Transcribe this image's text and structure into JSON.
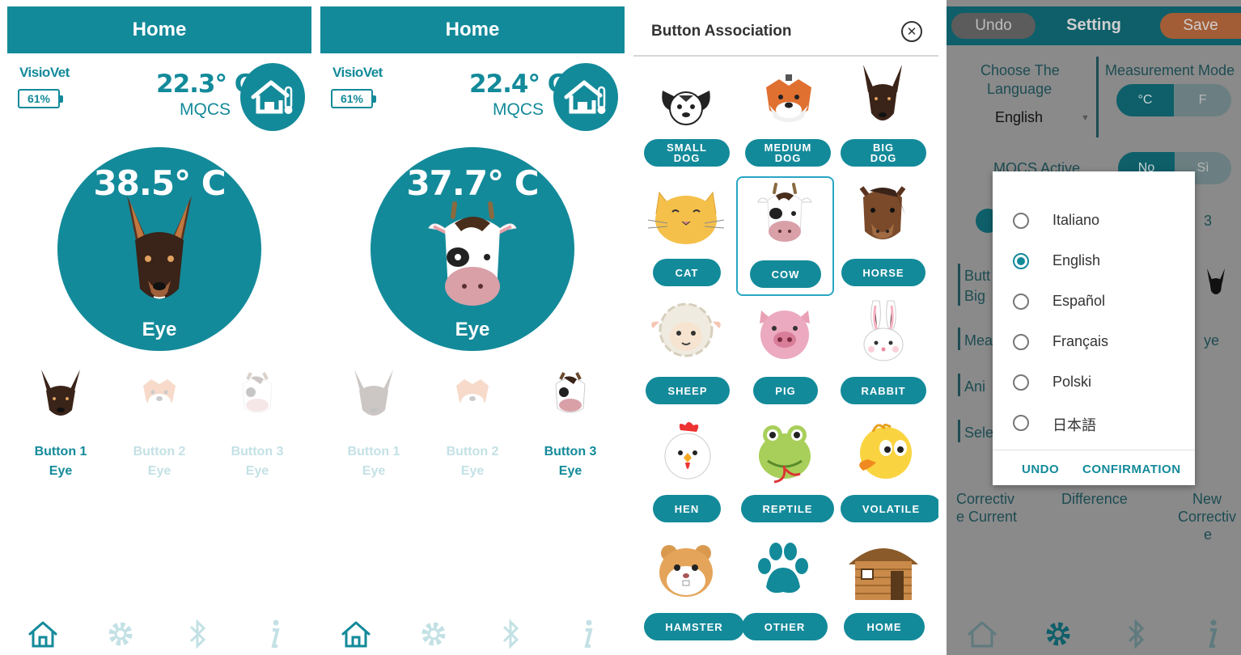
{
  "screen1": {
    "title": "Home",
    "brand": "VisioVet",
    "battery": "61%",
    "ambient_temp": "22.3° C",
    "ambient_label": "MQCS",
    "body_temp": "38.5° C",
    "body_site": "Eye",
    "buttons": [
      {
        "label": "Button 1",
        "site": "Eye",
        "active": true
      },
      {
        "label": "Button 2",
        "site": "Eye",
        "active": false
      },
      {
        "label": "Button 3",
        "site": "Eye",
        "active": false
      }
    ]
  },
  "screen2": {
    "title": "Home",
    "brand": "VisioVet",
    "battery": "61%",
    "ambient_temp": "22.4° C",
    "ambient_label": "MQCS",
    "body_temp": "37.7° C",
    "body_site": "Eye",
    "buttons": [
      {
        "label": "Button 1",
        "site": "Eye",
        "active": false
      },
      {
        "label": "Button 2",
        "site": "Eye",
        "active": false
      },
      {
        "label": "Button 3",
        "site": "Eye",
        "active": true
      }
    ]
  },
  "assoc": {
    "title": "Button Association",
    "animals": [
      {
        "l1": "SMALL",
        "l2": "DOG"
      },
      {
        "l1": "MEDIUM",
        "l2": "DOG"
      },
      {
        "l1": "BIG",
        "l2": "DOG"
      },
      {
        "l1": "CAT",
        "l2": ""
      },
      {
        "l1": "COW",
        "l2": ""
      },
      {
        "l1": "HORSE",
        "l2": ""
      },
      {
        "l1": "SHEEP",
        "l2": ""
      },
      {
        "l1": "PIG",
        "l2": ""
      },
      {
        "l1": "RABBIT",
        "l2": ""
      },
      {
        "l1": "HEN",
        "l2": ""
      },
      {
        "l1": "REPTILE",
        "l2": ""
      },
      {
        "l1": "VOLATILE",
        "l2": ""
      },
      {
        "l1": "HAMSTER",
        "l2": ""
      },
      {
        "l1": "OTHER",
        "l2": ""
      },
      {
        "l1": "HOME",
        "l2": ""
      }
    ]
  },
  "settings": {
    "undo": "Undo",
    "title": "Setting",
    "save": "Save",
    "lang_label_1": "Choose The",
    "lang_label_2": "Language",
    "lang_value": "English",
    "mode_label": "Measurement Mode",
    "mode_c": "°C",
    "mode_f": "F",
    "mqcs_label": "MQCS Active",
    "mqcs_no": "No",
    "mqcs_si": "Sì",
    "frag_butt": "Butt",
    "frag_big": "Big",
    "frag_mea": "Mea",
    "frag_ani": "Ani",
    "frag_sele": "Sele",
    "frag_ye": "ye",
    "frag_3": "3",
    "corr1": "Correctiv",
    "corr2": "e Current",
    "diff": "Difference",
    "new1": "New",
    "new2": "Correctiv",
    "new3": "e",
    "dialog": {
      "options": [
        "Italiano",
        "English",
        "Español",
        "Français",
        "Polski",
        "日本語"
      ],
      "selected": "English",
      "undo": "UNDO",
      "confirm": "CONFIRMATION"
    }
  }
}
